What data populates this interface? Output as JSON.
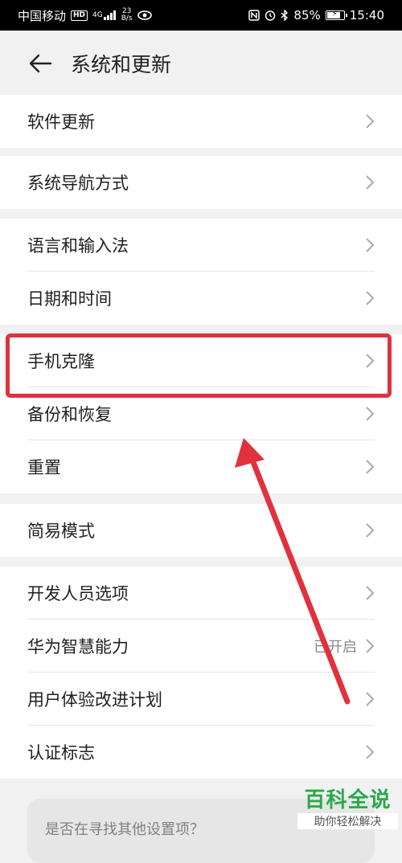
{
  "status_bar": {
    "carrier": "中国移动",
    "hd": "HD",
    "net_gen": "4G",
    "speed_value": "23",
    "speed_unit": "B/s",
    "battery": "85%",
    "battery_level": 0.85,
    "time": "15:40"
  },
  "header": {
    "title": "系统和更新"
  },
  "sections": [
    {
      "items": [
        {
          "label": "软件更新"
        }
      ]
    },
    {
      "items": [
        {
          "label": "系统导航方式"
        }
      ]
    },
    {
      "items": [
        {
          "label": "语言和输入法"
        },
        {
          "label": "日期和时间"
        }
      ]
    },
    {
      "items": [
        {
          "label": "手机克隆"
        },
        {
          "label": "备份和恢复"
        },
        {
          "label": "重置"
        }
      ]
    },
    {
      "items": [
        {
          "label": "简易模式"
        }
      ]
    },
    {
      "items": [
        {
          "label": "开发人员选项"
        },
        {
          "label": "华为智慧能力",
          "value": "已开启"
        },
        {
          "label": "用户体验改进计划"
        },
        {
          "label": "认证标志"
        }
      ]
    }
  ],
  "search_card": {
    "text": "是否在寻找其他设置项？"
  },
  "watermark": {
    "main": "百科全说",
    "sub": "助你轻松解决"
  },
  "colors": {
    "annotation": "#e0313f",
    "watermark": "#2aa84a"
  }
}
